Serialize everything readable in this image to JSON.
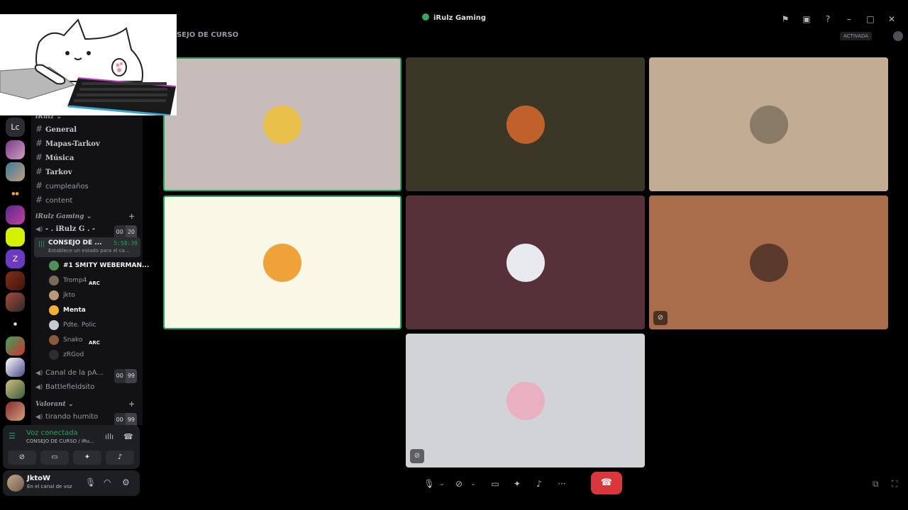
{
  "window": {
    "title": "iRulz Gaming",
    "controls": [
      "flag-icon",
      "inbox-icon",
      "help-icon",
      "minimize-icon",
      "maximize-icon",
      "close-icon"
    ]
  },
  "server": {
    "name": "iRulz",
    "rail_labels": [
      "Lc"
    ]
  },
  "sidebar": {
    "category_top": "iRulz",
    "text_channels": [
      "General",
      "Mapas-Tarkov",
      "Música",
      "Tarkov",
      "cumpleaños",
      "content"
    ],
    "category_voice": "iRulz Gaming",
    "voice_lobby": {
      "name": "- . iRulz G . -",
      "count_a": "00",
      "count_b": "20"
    },
    "active_channel": {
      "name": "CONSEJO DE ...",
      "timer": "5:58:39",
      "status": "Establece un estado para el ca..."
    },
    "members": [
      {
        "name": "#1 SMITY WEBERMAN...",
        "tag": "",
        "bright": true,
        "color": "#4e8f5a"
      },
      {
        "name": "Tromp4",
        "tag": "ARC",
        "bright": false,
        "color": "#7a6a5a"
      },
      {
        "name": "jkto",
        "tag": "",
        "bright": false,
        "color": "#b89a7a"
      },
      {
        "name": "Menta",
        "tag": "",
        "bright": true,
        "color": "#f0b232"
      },
      {
        "name": "Pdte. Polic",
        "tag": "",
        "bright": false,
        "color": "#c7c9d1"
      },
      {
        "name": "Snako",
        "tag": "ARC",
        "bright": false,
        "color": "#8a5a3a"
      },
      {
        "name": "zRGod",
        "tag": "",
        "bright": false,
        "color": "#2b2d31"
      }
    ],
    "voice_channels": [
      {
        "name": "Canal de la pA...",
        "count_a": "00",
        "count_b": "99"
      },
      {
        "name": "Battlefieldsito"
      }
    ],
    "category_valorant": "Valorant",
    "valorant_channel": {
      "name": "tirando humito",
      "count_a": "00",
      "count_b": "99"
    }
  },
  "voice_panel": {
    "title": "Voz conectada",
    "subtitle": "CONSEJO DE CURSO / iRu..."
  },
  "user_panel": {
    "name": "JktoW",
    "status": "En el canal de voz"
  },
  "main": {
    "channel_title": "CONSEJO DE CURSO",
    "live_badge": "ACTIVADA"
  },
  "tiles": [
    {
      "bg": "#c8bcbb",
      "speaking": true,
      "cam_off": false,
      "avatar": "#e8c04a"
    },
    {
      "bg": "#3b3726",
      "speaking": false,
      "cam_off": false,
      "avatar": "#c0602a"
    },
    {
      "bg": "#c2ac94",
      "speaking": false,
      "cam_off": false,
      "avatar": "#8a7a68"
    },
    {
      "bg": "#f9f8e6",
      "speaking": true,
      "cam_off": false,
      "avatar": "#f0a23a"
    },
    {
      "bg": "#56313a",
      "speaking": false,
      "cam_off": false,
      "avatar": "#e8eaf0"
    },
    {
      "bg": "#a96d4c",
      "speaking": false,
      "cam_off": true,
      "avatar": "#5a3a2a"
    },
    {
      "bg": "#d2d3d7",
      "speaking": false,
      "cam_off": true,
      "avatar": "#e8b0c0"
    }
  ],
  "colors": {
    "accent_green": "#23a55a",
    "hangup_red": "#da373c",
    "discord_blurple": "#5865f2"
  }
}
